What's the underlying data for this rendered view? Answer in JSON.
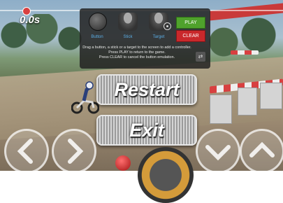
{
  "hud": {
    "timer": "0.0s"
  },
  "editor_panel": {
    "tools": [
      {
        "label": "Button"
      },
      {
        "label": "Stick"
      },
      {
        "label": "Target"
      }
    ],
    "play_label": "PLAY",
    "clear_label": "CLEAR",
    "instructions": [
      "Drag a button, a stick or a target to the screen to add a controller.",
      "Press PLAY to return to the game.",
      "Press CLEAR to cancel the button emulation."
    ]
  },
  "menu": {
    "restart_label": "Restart",
    "exit_label": "Exit"
  },
  "controls": {
    "left_icon": "chevron-left-icon",
    "right_icon": "chevron-right-icon",
    "down_icon": "chevron-down-icon",
    "up_icon": "chevron-up-icon"
  },
  "colors": {
    "play": "#4fa22c",
    "clear": "#c9282b",
    "tool_label": "#5aaee6"
  }
}
